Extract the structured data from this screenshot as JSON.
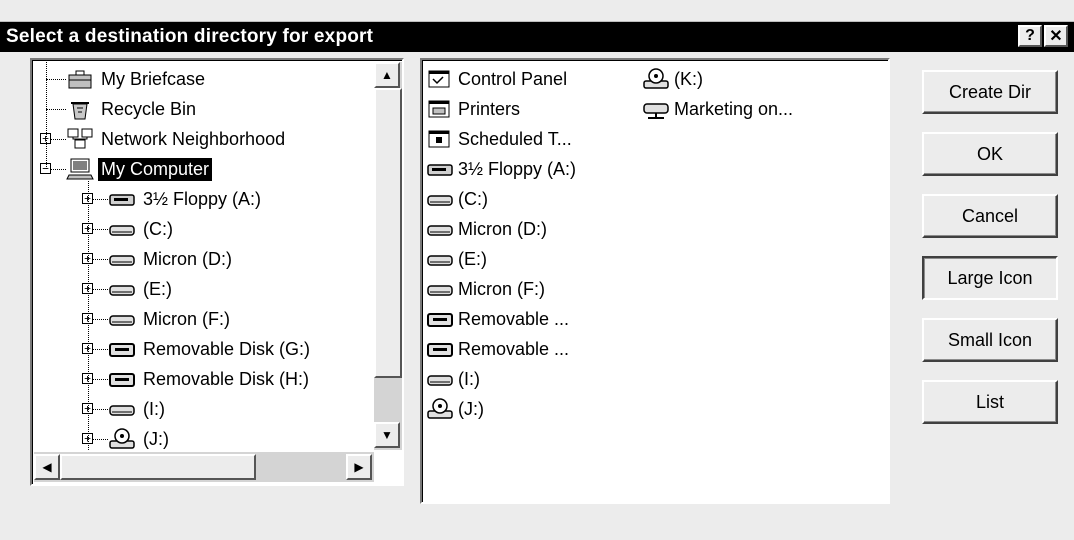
{
  "dialog": {
    "title": "Select a destination directory for export",
    "help_label": "?",
    "close_label": "✕"
  },
  "tree": {
    "items": [
      {
        "label": "My Briefcase",
        "icon": "briefcase-icon",
        "expandable": false,
        "selected": false
      },
      {
        "label": "Recycle Bin",
        "icon": "recycle-bin-icon",
        "expandable": false,
        "selected": false
      },
      {
        "label": "Network Neighborhood",
        "icon": "network-icon",
        "expandable": true,
        "selected": false
      },
      {
        "label": "My Computer",
        "icon": "computer-icon",
        "expandable": true,
        "expanded": true,
        "selected": true
      },
      {
        "label": "3½ Floppy (A:)",
        "icon": "floppy-drive-icon",
        "expandable": true,
        "selected": false
      },
      {
        "label": "(C:)",
        "icon": "hard-drive-icon",
        "expandable": true,
        "selected": false
      },
      {
        "label": "Micron (D:)",
        "icon": "hard-drive-icon",
        "expandable": true,
        "selected": false
      },
      {
        "label": "(E:)",
        "icon": "hard-drive-icon",
        "expandable": true,
        "selected": false
      },
      {
        "label": "Micron (F:)",
        "icon": "hard-drive-icon",
        "expandable": true,
        "selected": false
      },
      {
        "label": "Removable Disk (G:)",
        "icon": "removable-disk-icon",
        "expandable": true,
        "selected": false
      },
      {
        "label": "Removable Disk (H:)",
        "icon": "removable-disk-icon",
        "expandable": true,
        "selected": false
      },
      {
        "label": "(I:)",
        "icon": "hard-drive-icon",
        "expandable": true,
        "selected": false
      },
      {
        "label": "(J:)",
        "icon": "cd-drive-icon",
        "expandable": true,
        "selected": false
      }
    ]
  },
  "files": {
    "col1": [
      {
        "label": "Control Panel",
        "icon": "control-panel-icon"
      },
      {
        "label": "Printers",
        "icon": "printers-icon"
      },
      {
        "label": "Scheduled T...",
        "icon": "scheduled-tasks-icon"
      },
      {
        "label": "3½ Floppy (A:)",
        "icon": "floppy-drive-icon"
      },
      {
        "label": "(C:)",
        "icon": "hard-drive-icon"
      },
      {
        "label": "Micron (D:)",
        "icon": "hard-drive-icon"
      },
      {
        "label": "(E:)",
        "icon": "hard-drive-icon"
      },
      {
        "label": "Micron (F:)",
        "icon": "hard-drive-icon"
      },
      {
        "label": "Removable ...",
        "icon": "removable-disk-icon"
      },
      {
        "label": "Removable ...",
        "icon": "removable-disk-icon"
      },
      {
        "label": "(I:)",
        "icon": "hard-drive-icon"
      },
      {
        "label": "(J:)",
        "icon": "cd-drive-icon"
      }
    ],
    "col2": [
      {
        "label": "(K:)",
        "icon": "cd-drive-icon"
      },
      {
        "label": "Marketing on...",
        "icon": "network-drive-icon"
      }
    ]
  },
  "buttons": [
    {
      "label": "Create Dir",
      "pressed": false
    },
    {
      "label": "OK",
      "pressed": false
    },
    {
      "label": "Cancel",
      "pressed": false
    },
    {
      "label": "Large Icon",
      "pressed": true
    },
    {
      "label": "Small Icon",
      "pressed": false
    },
    {
      "label": "List",
      "pressed": false
    }
  ],
  "scroll": {
    "up_arrow": "▲",
    "down_arrow": "▼",
    "left_arrow": "◀",
    "right_arrow": "▶"
  }
}
